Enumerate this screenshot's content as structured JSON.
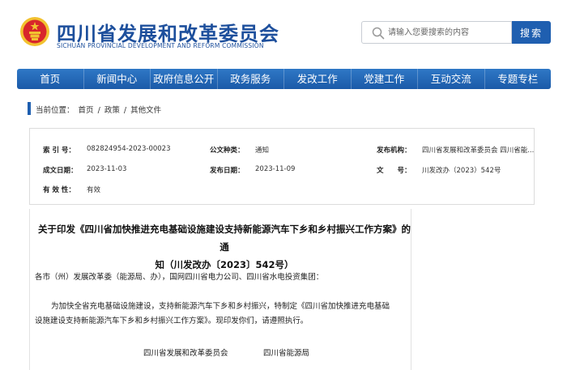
{
  "header": {
    "title": "四川省发展和改革委员会",
    "subtitle": "SICHUAN PROVINCIAL DEVELOPMENT AND REFORM COMMISSION",
    "search_placeholder": "请输入您要搜索的内容",
    "search_button": "搜索"
  },
  "nav": {
    "items": [
      "首页",
      "新闻中心",
      "政府信息公开",
      "政务服务",
      "发改工作",
      "党建工作",
      "互动交流",
      "专题专栏"
    ]
  },
  "breadcrumb": {
    "prefix": "当前位置：",
    "items": [
      "首页",
      "政策",
      "其他文件"
    ],
    "separator": "/"
  },
  "meta": {
    "index_label": "索 引 号：",
    "index_value": "082824954-2023-00023",
    "type_label": "公文种类：",
    "type_value": "通知",
    "org_label": "发布机构：",
    "org_value": "四川省发展和改革委员会 四川省能...",
    "created_label": "成文日期：",
    "created_value": "2023-11-03",
    "published_label": "发布日期：",
    "published_value": "2023-11-09",
    "docno_label": "文　　号：",
    "docno_value": "川发改办（2023）542号",
    "valid_label": "有 效 性：",
    "valid_value": "有效"
  },
  "document": {
    "title_line1": "关于印发《四川省加快推进充电基础设施建设支持新能源汽车下乡和乡村振兴工作方案》的通",
    "title_line2": "知（川发改办〔2023〕542号）",
    "recipients": "各市（州）发展改革委（能源局、办），国网四川省电力公司、四川省水电投资集团：",
    "body_line1": "为加快全省充电基础设施建设，支持新能源汽车下乡和乡村振兴，特制定《四川省加快推进充电基础",
    "body_line2": "设施建设支持新能源汽车下乡和乡村振兴工作方案》。现印发你们，请遵照执行。",
    "signer1": "四川省发展和改革委员会",
    "signer2": "四川省能源局"
  },
  "colors": {
    "brand_blue": "#1d4f9c",
    "nav_blue": "#1f5fb0",
    "emblem_red": "#d8262b",
    "emblem_gold": "#f2c230"
  },
  "icons": {
    "emblem": "national-emblem-icon",
    "search": "search-icon"
  }
}
